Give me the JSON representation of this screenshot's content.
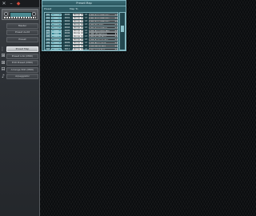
{
  "sidebar": {
    "titlebar_icons": [
      "close-icon",
      "minimize-icon",
      "app-icon"
    ],
    "nav": [
      {
        "label": "Master",
        "icon": ""
      },
      {
        "label": "Preset Audit",
        "icon": ""
      },
      {
        "label": "Preset",
        "icon": ""
      },
      {
        "label": "Preset Map",
        "icon": "⋮⋮",
        "active": true
      },
      {
        "label": "Preset Link (MIDI)",
        "icon": "⊞"
      },
      {
        "label": "Edit Preset (MIDI)",
        "icon": "⊞"
      },
      {
        "label": "Arrange Edit (MIDI)",
        "icon": "⊟"
      },
      {
        "label": "Arpeggiator",
        "icon": "♪"
      }
    ]
  },
  "window": {
    "title": "Preset Map",
    "header_preset": "Preset",
    "header_mapto": "Map To",
    "rows": [
      {
        "num": "01",
        "lcd": "0000",
        "code": "0000",
        "sel": "Rompr",
        "val": "13",
        "target": "003 P-Ano/Rhodes"
      },
      {
        "num": "02",
        "lcd": "0001",
        "code": "0001",
        "sel": "Rompr",
        "val": "13",
        "target": "001 P-Ano/Rhodes"
      },
      {
        "num": "03",
        "lcd": "0002",
        "code": "0002",
        "sel": "Rompr",
        "val": "13",
        "target": "002 P-Ano/Rhodes"
      },
      {
        "num": "04",
        "lcd": "0003",
        "code": "0003",
        "sel": "Rompr",
        "val": "13",
        "target": "003 Slw Strg"
      },
      {
        "num": "05",
        "lcd": "0004",
        "code": "0004",
        "sel": "Rompr",
        "val": "13",
        "target": "004 Sweet Strgs"
      },
      {
        "num": "06",
        "lcd": "0005",
        "code": "0005",
        "sel": "Rompr",
        "val": "13",
        "target": "005 Ensemble Blw"
      },
      {
        "num": "07",
        "lcd": "0006",
        "code": "0006",
        "sel": "Rompr",
        "val": "13",
        "target": "006 Vibraphone"
      },
      {
        "num": "08",
        "lcd": "0007",
        "code": "0007",
        "sel": "Rompr",
        "val": "13",
        "target": "007 Synth Bass"
      },
      {
        "num": "09",
        "lcd": "0008",
        "code": "0008",
        "sel": "Rompr",
        "val": "13",
        "target": "008 Funky Guitar"
      },
      {
        "num": "10",
        "lcd": "0009",
        "code": "0009",
        "sel": "Rompr",
        "val": "13",
        "target": "009 Brass Sect"
      },
      {
        "num": "11",
        "lcd": "0010",
        "code": "0010",
        "sel": "Rompr",
        "val": "13",
        "target": "010 Warm Pad"
      },
      {
        "num": "12",
        "lcd": "0011",
        "code": "0011",
        "sel": "Rompr",
        "val": "13",
        "target": "011 Lead Saw"
      }
    ]
  },
  "colors": {
    "window_bg": "#2d5a63",
    "window_border": "#7fb3bd",
    "lcd": "#2e7f8c",
    "workspace": "#0a0c0e",
    "active_nav": "#c0c4c8"
  }
}
